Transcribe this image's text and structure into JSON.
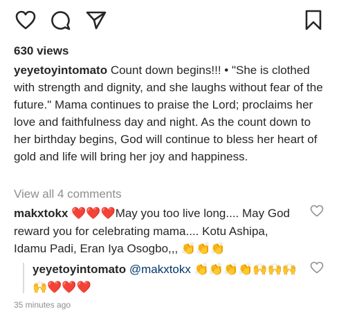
{
  "post": {
    "views": "630 views",
    "caption_username": "yeyetoyintomato",
    "caption_text": "Count down begins!!! • \"She is clothed with strength and dignity, and she laughs without fear of the future.\" Mama continues to praise the Lord; proclaims her love and faithfulness day and night. As the count down to her birthday begins, God will continue to bless her heart of gold and life will bring her joy and happiness.",
    "view_all_comments": "View all 4 comments",
    "timestamp": "35 minutes ago"
  },
  "comments": [
    {
      "username": "makxtokx",
      "prefix_emoji": "❤️❤️❤️",
      "text": "May you too live long.... May God reward you for celebrating mama.... Kotu Ashipa, Idamu Padi, Eran Iya Osogbo,,,",
      "suffix_emoji": "👏👏👏"
    },
    {
      "username": "yeyetoyintomato",
      "text": "@makxtokx",
      "suffix_emoji": "👏👏👏👏🙌🙌🙌🙌❤️❤️❤️"
    }
  ],
  "icons": {
    "like": "heart-icon",
    "comment": "comment-icon",
    "share": "share-icon",
    "save": "bookmark-icon",
    "comment_like": "heart-outline-icon"
  },
  "colors": {
    "text": "#262626",
    "muted": "#8e8e8e",
    "heart_emoji": "#e0245e",
    "clap_emoji": "#f5b100"
  }
}
